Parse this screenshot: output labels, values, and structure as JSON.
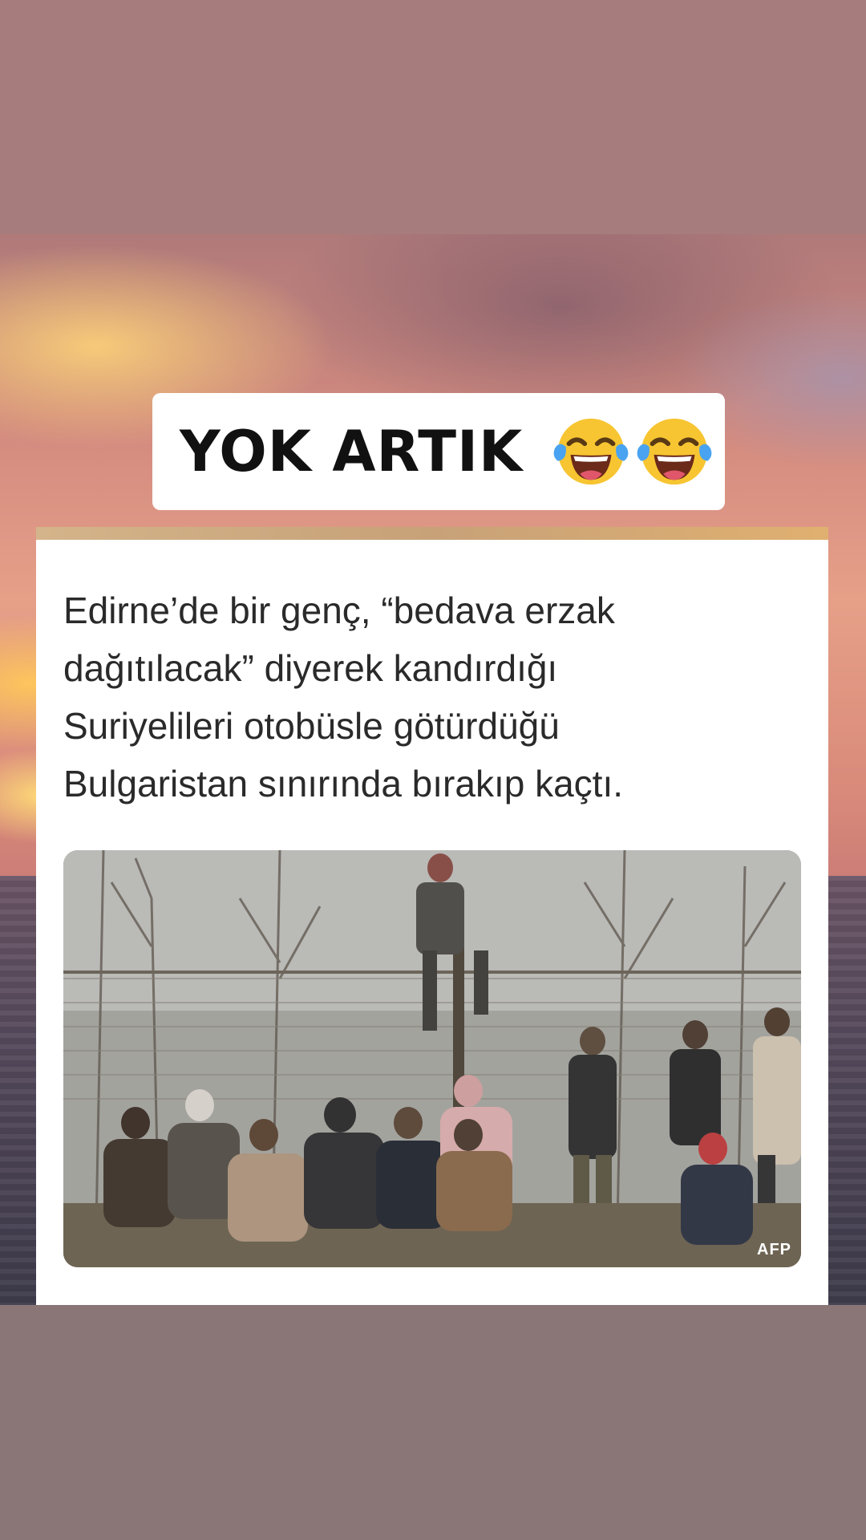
{
  "title": {
    "text": "YOK ARTIK",
    "emojis": [
      "laughing-crying-emoji",
      "laughing-crying-emoji"
    ]
  },
  "post": {
    "headline_lines": [
      "Edirne’de bir genç, “bedava erzak",
      "dağıtılacak” diyerek kandırdığı",
      "Suriyelileri otobüsle götürdüğü",
      "Bulgaristan sınırında bırakıp kaçtı."
    ],
    "photo_credit": "AFP"
  },
  "colors": {
    "top_band": "#a67c7c",
    "bottom_band": "#8a7676",
    "card_accent": "#c7a178",
    "text": "#2a2a2a"
  }
}
